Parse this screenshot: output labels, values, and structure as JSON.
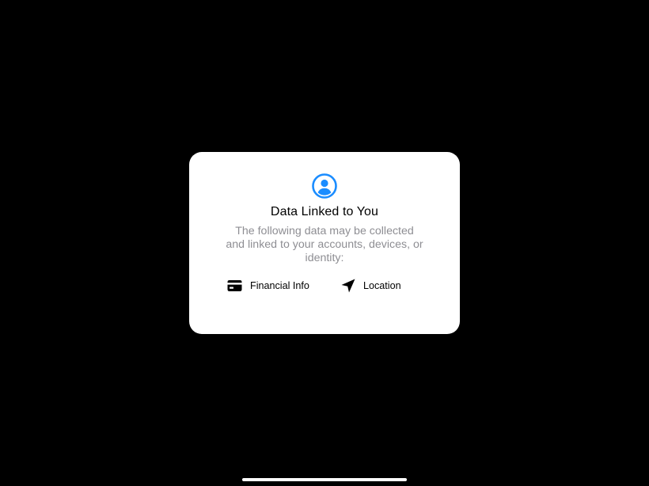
{
  "colors": {
    "background": "#000000",
    "card": "#ffffff",
    "accent": "#1a8cff",
    "title_text": "#000000",
    "secondary_text": "#8e8e93"
  },
  "card": {
    "header_icon": "person-circle-icon",
    "title": "Data Linked to You",
    "subtitle": "The following data may be collected and linked to your accounts, devices, or identity:",
    "items": [
      {
        "icon": "credit-card-icon",
        "label": "Financial Info"
      },
      {
        "icon": "location-arrow-icon",
        "label": "Location"
      }
    ]
  },
  "system": {
    "home_indicator": "home-indicator"
  }
}
